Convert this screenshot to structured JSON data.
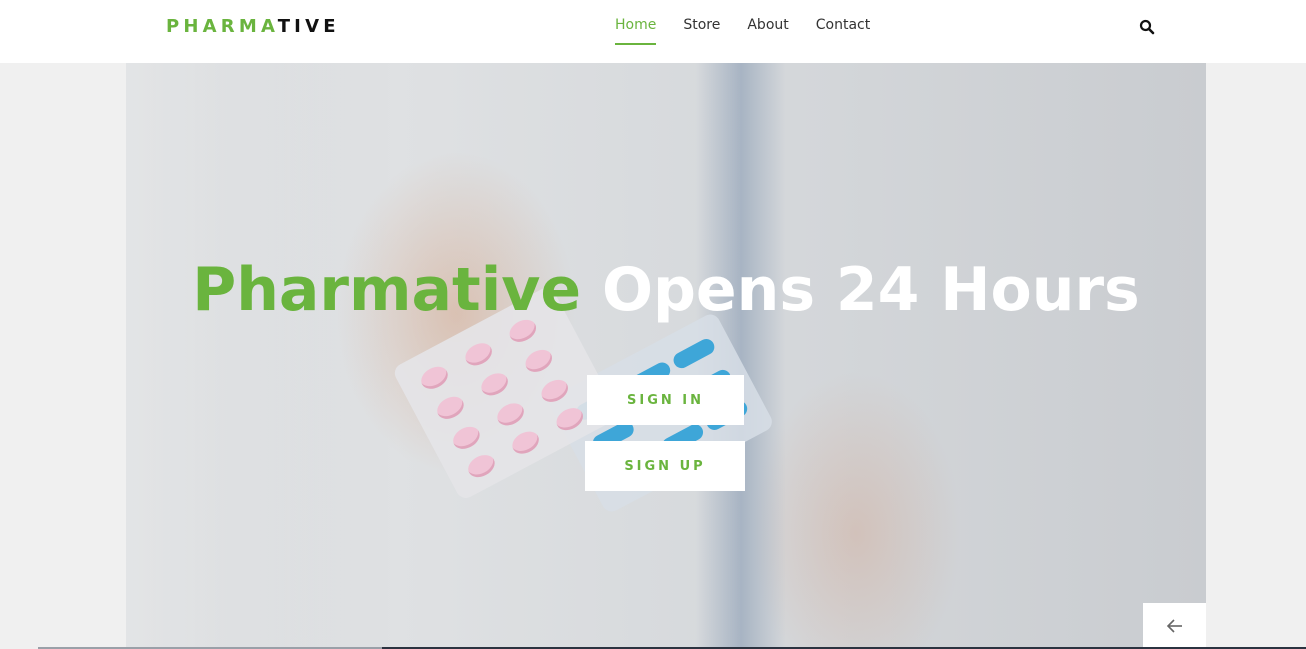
{
  "brand": {
    "logo_part1": "PHARMA",
    "logo_part2": "TIVE",
    "color_green": "#6ab43e"
  },
  "nav": {
    "items": [
      {
        "label": "Home",
        "active": true
      },
      {
        "label": "Store",
        "active": false
      },
      {
        "label": "About",
        "active": false
      },
      {
        "label": "Contact",
        "active": false
      }
    ],
    "search_icon": "search-icon"
  },
  "hero": {
    "headline_part1": "Pharmative",
    "headline_part2": "Opens 24 Hours",
    "sign_in_label": "SIGN IN",
    "sign_up_label": "SIGN UP",
    "prev_icon": "arrow-left-icon"
  }
}
